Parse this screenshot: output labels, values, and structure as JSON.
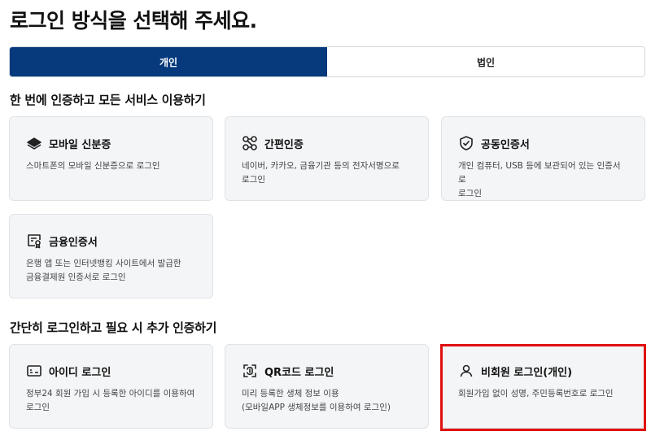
{
  "page_title": "로그인 방식을 선택해 주세요.",
  "tabs": [
    {
      "label": "개인",
      "active": true
    },
    {
      "label": "법인",
      "active": false
    }
  ],
  "sections": [
    {
      "title": "한 번에 인증하고 모든 서비스 이용하기",
      "cards": [
        {
          "icon": "mobile-id-icon",
          "title": "모바일 신분증",
          "desc": "스마트폰의 모바일 신분증으로 로그인"
        },
        {
          "icon": "simple-auth-icon",
          "title": "간편인증",
          "desc": "네이버, 카카오, 금융기관 등의 전자서명으로\n로그인"
        },
        {
          "icon": "shield-check-icon",
          "title": "공동인증서",
          "desc": "개인 컴퓨터, USB 등에 보관되어 있는 인증서로\n로그인"
        },
        {
          "icon": "certificate-icon",
          "title": "금융인증서",
          "desc": "은행 앱 또는 인터넷뱅킹 사이트에서 발급한\n금융결제원 인증서로 로그인"
        }
      ]
    },
    {
      "title": "간단히 로그인하고 필요 시 추가 인증하기",
      "cards": [
        {
          "icon": "id-card-icon",
          "title": "아이디 로그인",
          "desc": "정부24 회원 가입 시 등록한 아이디를 이용하여\n로그인"
        },
        {
          "icon": "qr-code-icon",
          "title": "QR코드 로그인",
          "desc": "미리 등록한 생체 정보 이용\n(모바일APP 생체정보를 이용하여 로그인)"
        },
        {
          "icon": "user-icon",
          "title": "비회원 로그인(개인)",
          "desc": "회원가입 없이 성명, 주민등록번호로 로그인"
        }
      ]
    }
  ],
  "colors": {
    "accent": "#073a7c",
    "highlight": "#e0100f",
    "card_bg": "#f4f5f7"
  }
}
